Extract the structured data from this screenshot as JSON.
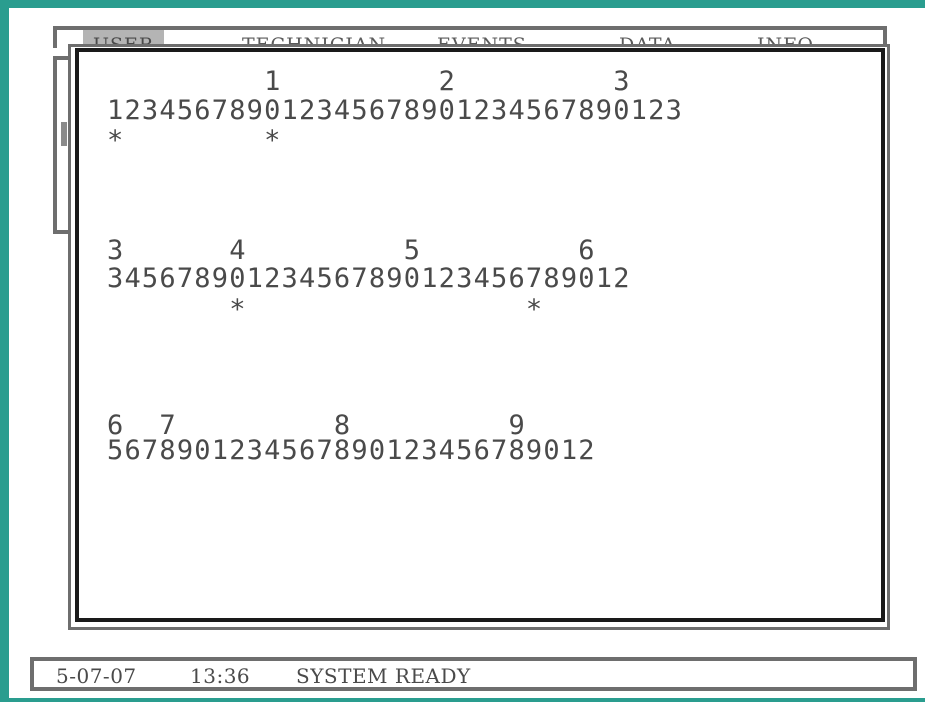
{
  "menu": {
    "items": [
      {
        "label": "USER"
      },
      {
        "label": "TECHNICIAN"
      },
      {
        "label": "EVENTS"
      },
      {
        "label": "DATA"
      },
      {
        "label": "INFO"
      }
    ]
  },
  "dialog": {
    "blocks": [
      {
        "tens": "         1         2         3",
        "digits": "123456789012345678901234567890123",
        "marks": "*        *"
      },
      {
        "tens": "3      4         5         6",
        "digits": "345678901234567890123456789012",
        "marks": "       *                *"
      },
      {
        "tens": "6  7         8         9",
        "digits": "5678901234567890123456789012",
        "marks": ""
      }
    ]
  },
  "status": {
    "date": "5-07-07",
    "time": "13:36",
    "message": "SYSTEM READY"
  }
}
